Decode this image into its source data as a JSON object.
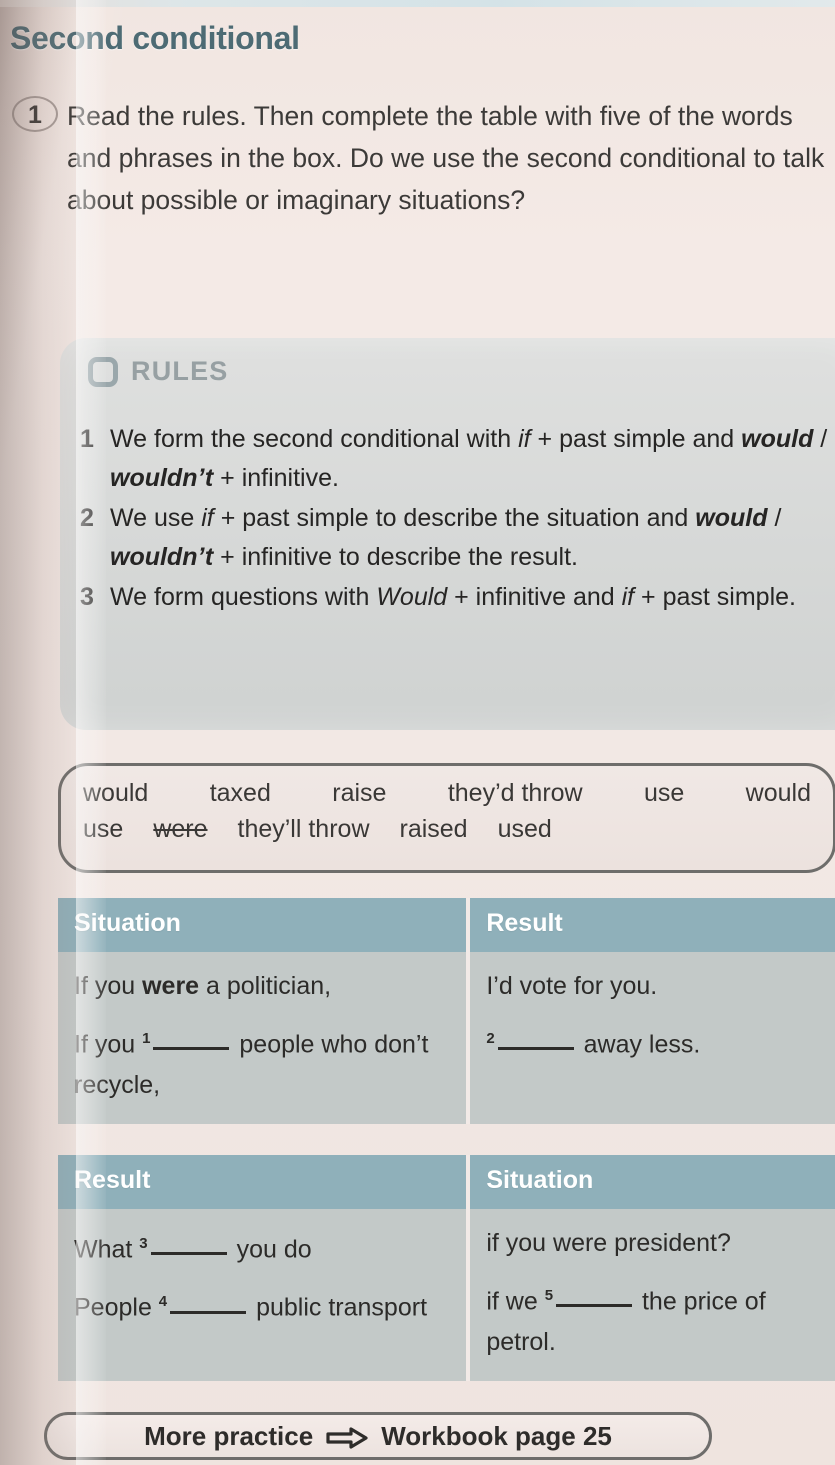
{
  "page": {
    "title": "Second conditional",
    "accent_header": "#8fb0ba",
    "title_color": "#4d6b74",
    "page_bg": "#f1e6e1"
  },
  "exercise": {
    "number": "1",
    "instruction": "Read the rules. Then complete the table with five of the words and phrases in the box. Do we use the second conditional to talk about possible or imaginary situations?"
  },
  "rules": {
    "icon": "rounded-square-icon",
    "label": "RULES",
    "items": [
      {
        "number": "1",
        "parts": [
          {
            "t": "We form the second conditional with ",
            "s": "normal"
          },
          {
            "t": "if",
            "s": "italic"
          },
          {
            "t": " + past simple and ",
            "s": "normal"
          },
          {
            "t": "would",
            "s": "bold-italic"
          },
          {
            "t": " / ",
            "s": "normal"
          },
          {
            "t": "wouldn’t",
            "s": "bold-italic"
          },
          {
            "t": " + infinitive.",
            "s": "normal"
          }
        ]
      },
      {
        "number": "2",
        "parts": [
          {
            "t": "We use ",
            "s": "normal"
          },
          {
            "t": "if",
            "s": "italic"
          },
          {
            "t": " + past simple to describe the situation and ",
            "s": "normal"
          },
          {
            "t": "would",
            "s": "bold-italic"
          },
          {
            "t": " / ",
            "s": "normal"
          },
          {
            "t": "wouldn’t",
            "s": "bold-italic"
          },
          {
            "t": " + infinitive to describe the result.",
            "s": "normal"
          }
        ]
      },
      {
        "number": "3",
        "parts": [
          {
            "t": "We form questions with ",
            "s": "normal"
          },
          {
            "t": "Would",
            "s": "italic"
          },
          {
            "t": " + infinitive and ",
            "s": "normal"
          },
          {
            "t": "if",
            "s": "italic"
          },
          {
            "t": " + past simple.",
            "s": "normal"
          }
        ]
      }
    ]
  },
  "word_bank": {
    "row1": [
      {
        "word": "would",
        "struck": false
      },
      {
        "word": "taxed",
        "struck": false
      },
      {
        "word": "raise",
        "struck": false
      },
      {
        "word": "they’d throw",
        "struck": false
      },
      {
        "word": "use",
        "struck": false
      },
      {
        "word": "would",
        "struck": false
      }
    ],
    "row2": [
      {
        "word": "use",
        "struck": false
      },
      {
        "word": "were",
        "struck": true
      },
      {
        "word": "they’ll throw",
        "struck": false
      },
      {
        "word": "raised",
        "struck": false
      },
      {
        "word": "used",
        "struck": false
      }
    ]
  },
  "table1": {
    "headers": [
      "Situation",
      "Result"
    ],
    "rows": [
      {
        "situation": [
          {
            "t": "If you ",
            "s": "normal"
          },
          {
            "t": "were",
            "s": "bold"
          },
          {
            "t": " a politician,",
            "s": "normal"
          }
        ],
        "result": [
          {
            "t": "I’d vote for you.",
            "s": "normal"
          }
        ]
      },
      {
        "situation": [
          {
            "t": "If you ",
            "s": "normal"
          },
          {
            "t": "1",
            "s": "sup"
          },
          {
            "t": "",
            "s": "blank"
          },
          {
            "t": " people who don’t recycle,",
            "s": "normal"
          }
        ],
        "result": [
          {
            "t": "2",
            "s": "sup"
          },
          {
            "t": "",
            "s": "blank"
          },
          {
            "t": " away less.",
            "s": "normal"
          }
        ]
      }
    ]
  },
  "table2": {
    "headers": [
      "Result",
      "Situation"
    ],
    "rows": [
      {
        "result": [
          {
            "t": "What ",
            "s": "normal"
          },
          {
            "t": "3",
            "s": "sup"
          },
          {
            "t": "",
            "s": "blank"
          },
          {
            "t": " you do",
            "s": "normal"
          }
        ],
        "situation": [
          {
            "t": "if you were president?",
            "s": "normal"
          }
        ]
      },
      {
        "result": [
          {
            "t": "People ",
            "s": "normal"
          },
          {
            "t": "4",
            "s": "sup"
          },
          {
            "t": "",
            "s": "blank"
          },
          {
            "t": " public transport",
            "s": "normal"
          }
        ],
        "situation": [
          {
            "t": "if we ",
            "s": "normal"
          },
          {
            "t": "5",
            "s": "sup"
          },
          {
            "t": "",
            "s": "blank"
          },
          {
            "t": " the price of petrol.",
            "s": "normal"
          }
        ]
      }
    ]
  },
  "footer": {
    "label_left": "More practice",
    "icon": "right-arrow-icon",
    "label_right": "Workbook page 25"
  }
}
